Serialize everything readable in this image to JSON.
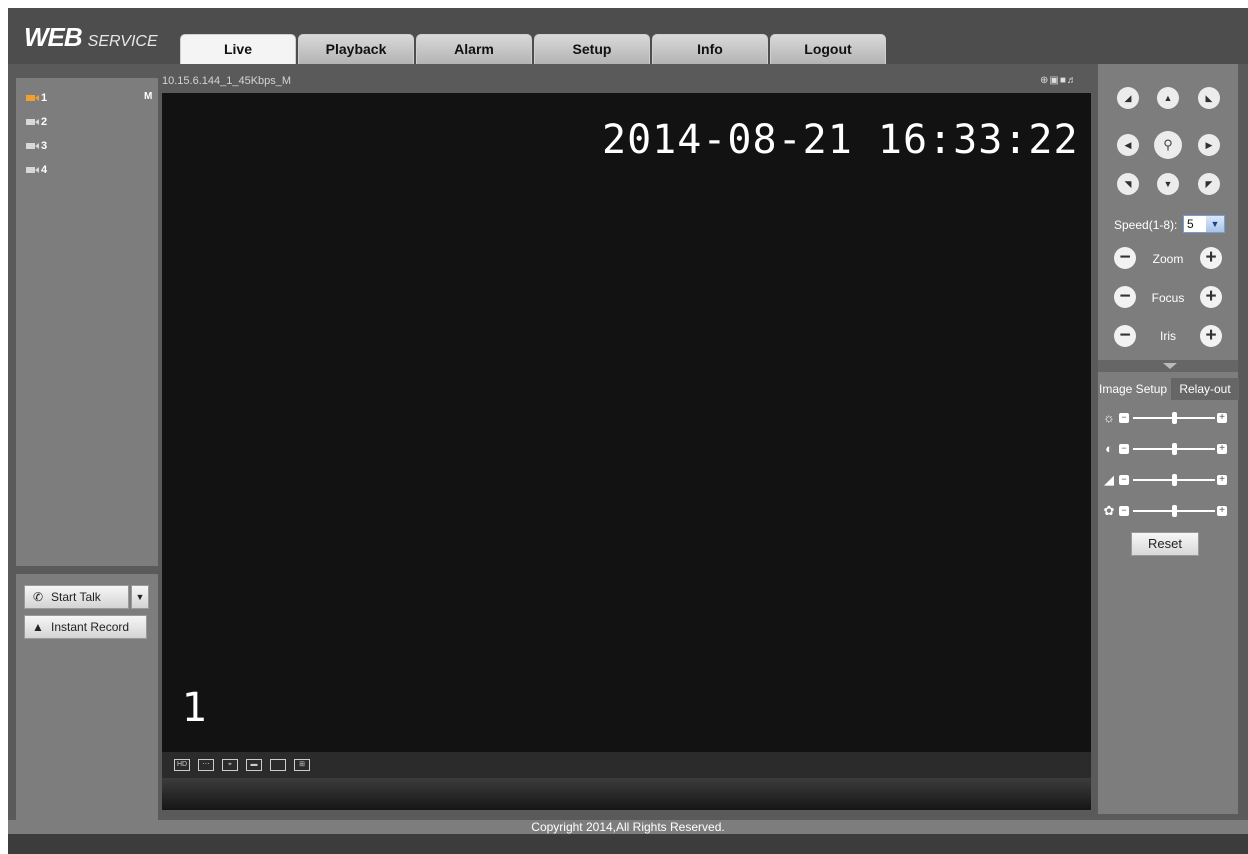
{
  "header": {
    "logo_main": "WEB",
    "logo_sub": "SERVICE",
    "tabs": [
      "Live",
      "Playback",
      "Alarm",
      "Setup",
      "Info",
      "Logout"
    ],
    "active_tab": "Live"
  },
  "channels": [
    {
      "label": "1",
      "active": true
    },
    {
      "label": "2",
      "active": false
    },
    {
      "label": "3",
      "active": false
    },
    {
      "label": "4",
      "active": false
    }
  ],
  "channel_stream_flag": "M",
  "left_controls": {
    "talk_label": "Start Talk",
    "record_label": "Instant Record"
  },
  "video": {
    "stream_label": "10.15.6.144_1_45Kbps_M",
    "osd_time": "2014-08-21 16:33:22",
    "osd_channel": "1"
  },
  "ptz": {
    "speed_label": "Speed(1-8):",
    "speed_value": "5",
    "zoom_label": "Zoom",
    "focus_label": "Focus",
    "iris_label": "Iris"
  },
  "image_tabs": [
    "Image Setup",
    "Relay-out"
  ],
  "image_adjust": [
    {
      "icon": "brightness-icon",
      "level": 0.5
    },
    {
      "icon": "contrast-icon",
      "level": 0.5
    },
    {
      "icon": "saturation-icon",
      "level": 0.5
    },
    {
      "icon": "hue-icon",
      "level": 0.5
    }
  ],
  "reset_label": "Reset",
  "footer": "Copyright 2014,All Rights Reserved."
}
